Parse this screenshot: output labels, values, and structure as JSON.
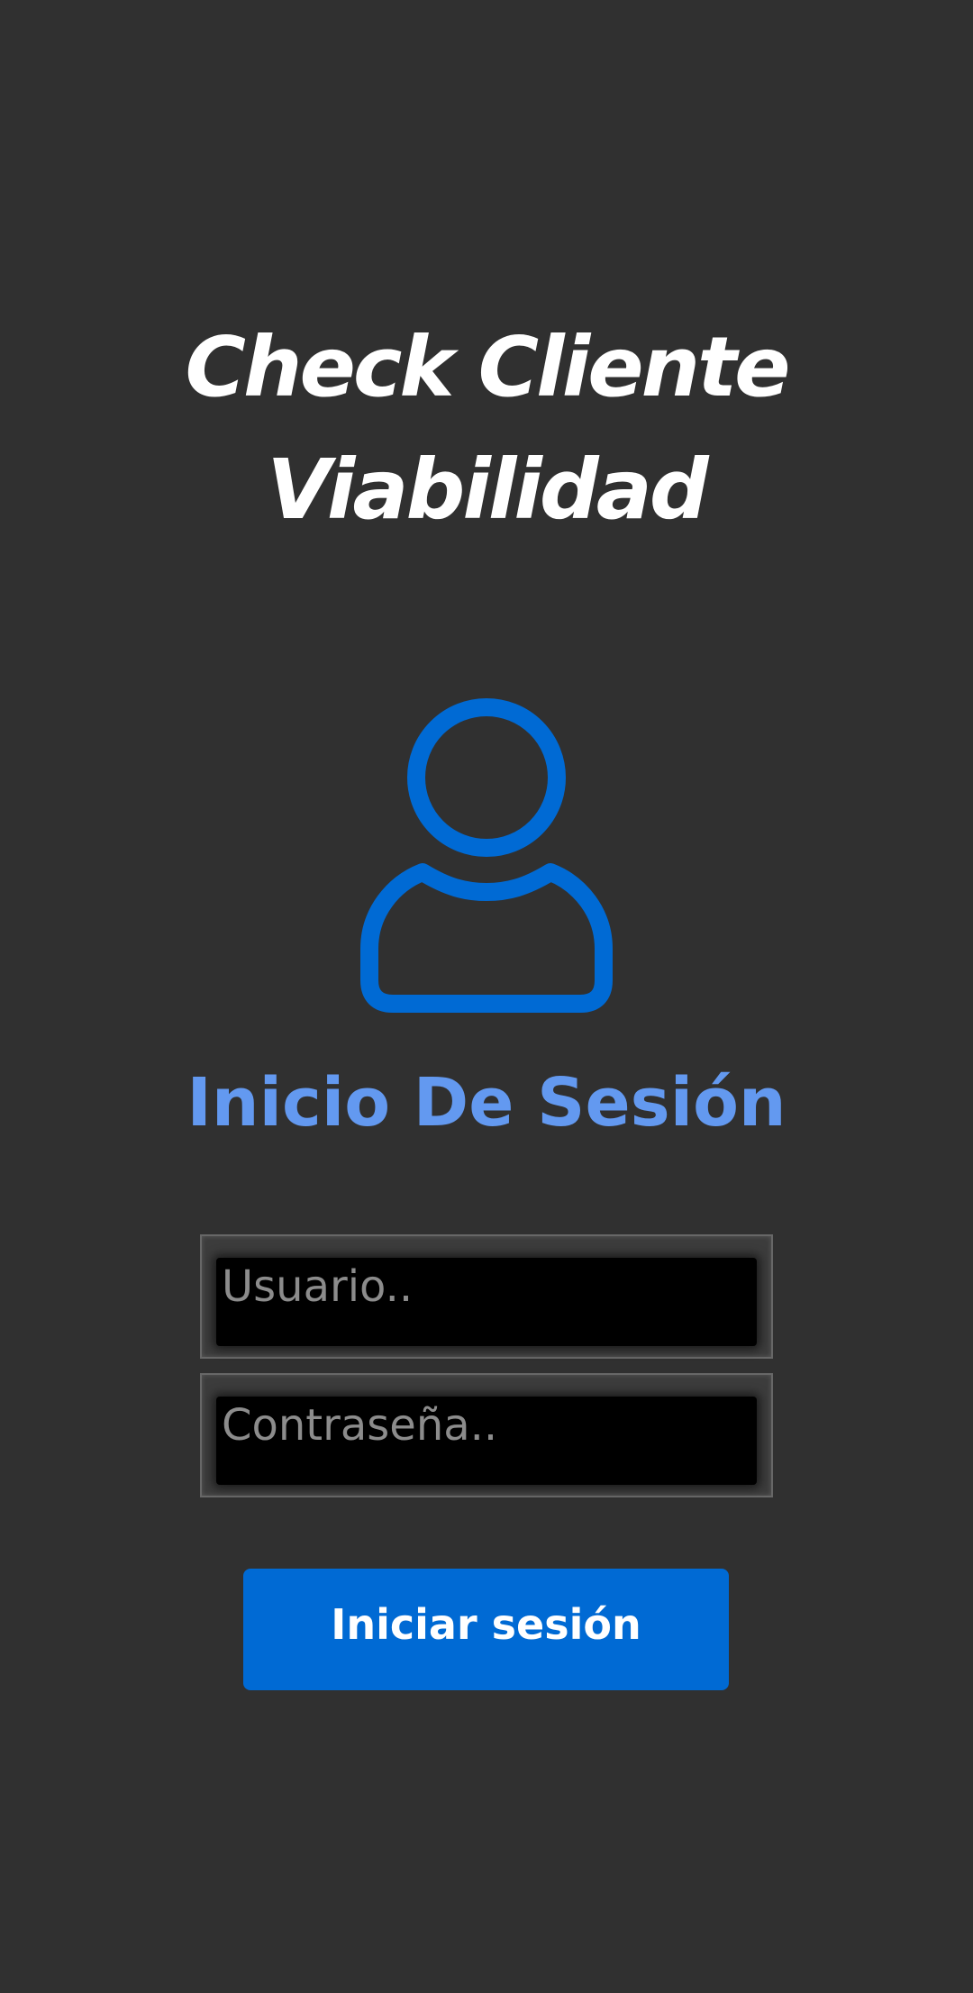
{
  "header": {
    "title_line1": "Check Cliente",
    "title_line2": "Viabilidad"
  },
  "avatar": {
    "icon": "user-icon",
    "color": "#006AD4"
  },
  "login": {
    "heading": "Inicio De Sesión",
    "username_placeholder": "Usuario..",
    "username_value": "",
    "password_placeholder": "Contraseña..",
    "password_value": "",
    "submit_label": "Iniciar sesión"
  },
  "colors": {
    "background": "#303030",
    "heading": "#6399F0",
    "button": "#006AD4"
  }
}
